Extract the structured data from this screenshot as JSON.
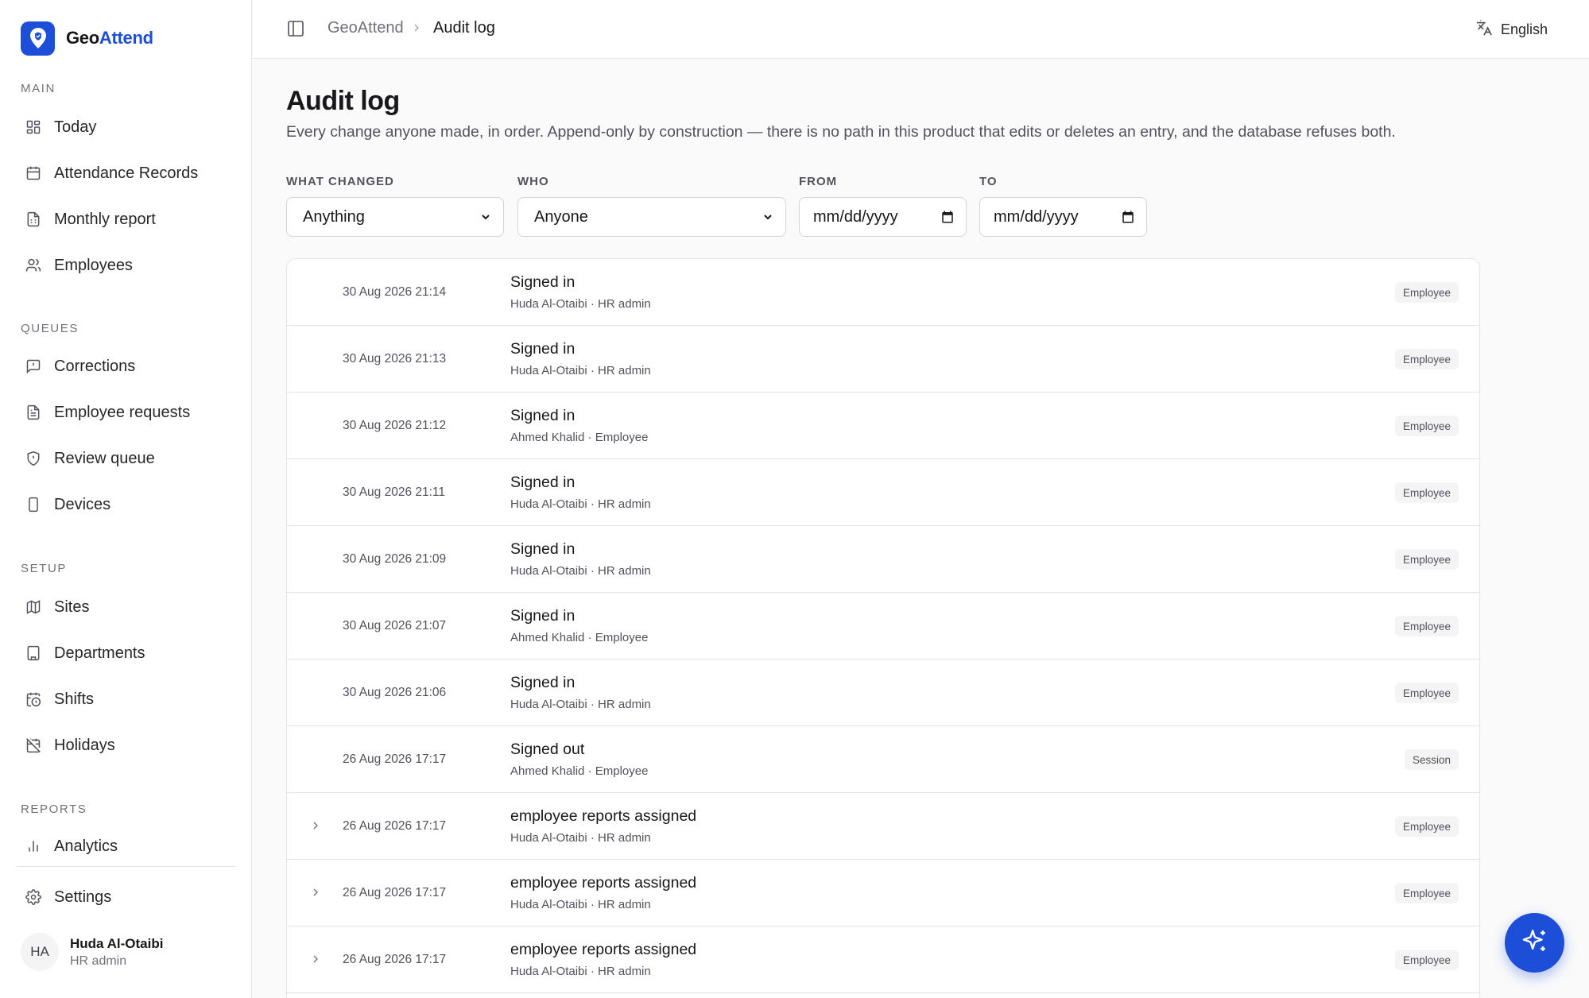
{
  "brand": {
    "name_a": "Geo",
    "name_b": "Attend",
    "accent": "#1d4ed8"
  },
  "sidebar": {
    "sections": [
      {
        "title": "MAIN",
        "items": [
          {
            "label": "Today",
            "icon": "dashboard-icon"
          },
          {
            "label": "Attendance Records",
            "icon": "calendar-icon"
          },
          {
            "label": "Monthly report",
            "icon": "report-icon"
          },
          {
            "label": "Employees",
            "icon": "users-icon"
          }
        ]
      },
      {
        "title": "QUEUES",
        "items": [
          {
            "label": "Corrections",
            "icon": "message-alert-icon"
          },
          {
            "label": "Employee requests",
            "icon": "document-icon"
          },
          {
            "label": "Review queue",
            "icon": "shield-alert-icon"
          },
          {
            "label": "Devices",
            "icon": "smartphone-icon"
          }
        ]
      },
      {
        "title": "SETUP",
        "items": [
          {
            "label": "Sites",
            "icon": "map-icon"
          },
          {
            "label": "Departments",
            "icon": "building-icon"
          },
          {
            "label": "Shifts",
            "icon": "calendar-clock-icon"
          },
          {
            "label": "Holidays",
            "icon": "calendar-off-icon"
          }
        ]
      },
      {
        "title": "REPORTS",
        "items": [
          {
            "label": "Analytics",
            "icon": "bar-chart-icon"
          }
        ]
      }
    ],
    "settings_label": "Settings",
    "user": {
      "initials": "HA",
      "name": "Huda Al-Otaibi",
      "role": "HR admin"
    }
  },
  "topbar": {
    "breadcrumb_root": "GeoAttend",
    "breadcrumb_current": "Audit log",
    "language": "English"
  },
  "page": {
    "title": "Audit log",
    "description": "Every change anyone made, in order. Append-only by construction — there is no path in this product that edits or deletes an entry, and the database refuses both."
  },
  "filters": {
    "what_changed": {
      "label": "WHAT CHANGED",
      "value": "Anything"
    },
    "who": {
      "label": "WHO",
      "value": "Anyone"
    },
    "from": {
      "label": "FROM",
      "value": "mm/dd/yyyy"
    },
    "to": {
      "label": "TO",
      "value": "mm/dd/yyyy"
    }
  },
  "log": [
    {
      "timestamp": "30 Aug 2026 21:14",
      "action": "Signed in",
      "actor": "Huda Al-Otaibi · HR admin",
      "badge": "Employee",
      "expandable": false
    },
    {
      "timestamp": "30 Aug 2026 21:13",
      "action": "Signed in",
      "actor": "Huda Al-Otaibi · HR admin",
      "badge": "Employee",
      "expandable": false
    },
    {
      "timestamp": "30 Aug 2026 21:12",
      "action": "Signed in",
      "actor": "Ahmed Khalid · Employee",
      "badge": "Employee",
      "expandable": false
    },
    {
      "timestamp": "30 Aug 2026 21:11",
      "action": "Signed in",
      "actor": "Huda Al-Otaibi · HR admin",
      "badge": "Employee",
      "expandable": false
    },
    {
      "timestamp": "30 Aug 2026 21:09",
      "action": "Signed in",
      "actor": "Huda Al-Otaibi · HR admin",
      "badge": "Employee",
      "expandable": false
    },
    {
      "timestamp": "30 Aug 2026 21:07",
      "action": "Signed in",
      "actor": "Ahmed Khalid · Employee",
      "badge": "Employee",
      "expandable": false
    },
    {
      "timestamp": "30 Aug 2026 21:06",
      "action": "Signed in",
      "actor": "Huda Al-Otaibi · HR admin",
      "badge": "Employee",
      "expandable": false
    },
    {
      "timestamp": "26 Aug 2026 17:17",
      "action": "Signed out",
      "actor": "Ahmed Khalid · Employee",
      "badge": "Session",
      "expandable": false
    },
    {
      "timestamp": "26 Aug 2026 17:17",
      "action": "employee reports assigned",
      "actor": "Huda Al-Otaibi · HR admin",
      "badge": "Employee",
      "expandable": true
    },
    {
      "timestamp": "26 Aug 2026 17:17",
      "action": "employee reports assigned",
      "actor": "Huda Al-Otaibi · HR admin",
      "badge": "Employee",
      "expandable": true
    },
    {
      "timestamp": "26 Aug 2026 17:17",
      "action": "employee reports assigned",
      "actor": "Huda Al-Otaibi · HR admin",
      "badge": "Employee",
      "expandable": true
    }
  ],
  "assistant_button_icon": "sparkles-icon"
}
